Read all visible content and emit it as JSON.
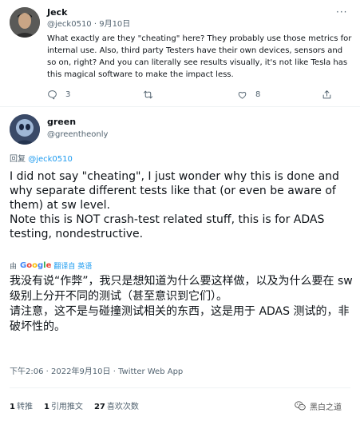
{
  "reply_tweet": {
    "name": "Jeck",
    "meta": "@jeck0510 · 9月10日",
    "more": "···",
    "text": "What exactly are they \"cheating\" here? They probably use those metrics for internal use. Also, third party Testers have their own devices, sensors and so on, right? And you can literally see results visually, it's not like Tesla has this magical software to make the impact less.",
    "actions": {
      "reply_count": "3",
      "retweet_count": "",
      "like_count": "8"
    }
  },
  "main_tweet": {
    "name": "green",
    "handle": "@greentheonly",
    "replying_prefix": "回复",
    "replying_to": "@jeck0510",
    "body_en": [
      "I did not say \"cheating\", I just wonder why this is done and why separate different tests like that (or even be aware of them) at sw level.",
      "Note this is NOT crash-test related stuff, this is for ADAS testing, nondestructive."
    ],
    "translate": {
      "prefix": "由",
      "provider": "Google",
      "service": "翻译自 英语"
    },
    "body_zh": [
      "我没有说“作弊”，我只是想知道为什么要这样做，以及为什么要在 sw 级别上分开不同的测试（甚至意识到它们）。",
      "请注意，这不是与碰撞测试相关的东西，这是用于 ADAS 测试的，非破坏性的。"
    ],
    "timestamp": "下午2:06 · 2022年9月10日 · Twitter Web App",
    "stats": [
      {
        "count": "1",
        "label": "转推"
      },
      {
        "count": "1",
        "label": "引用推文"
      },
      {
        "count": "27",
        "label": "喜欢次数"
      }
    ]
  },
  "watermark": {
    "text": "黑白之道",
    "icon": "wechat-icon"
  },
  "colors": {
    "text": "#0f1419",
    "muted": "#536471",
    "link": "#1d9bf0",
    "divider": "#eff3f4"
  }
}
